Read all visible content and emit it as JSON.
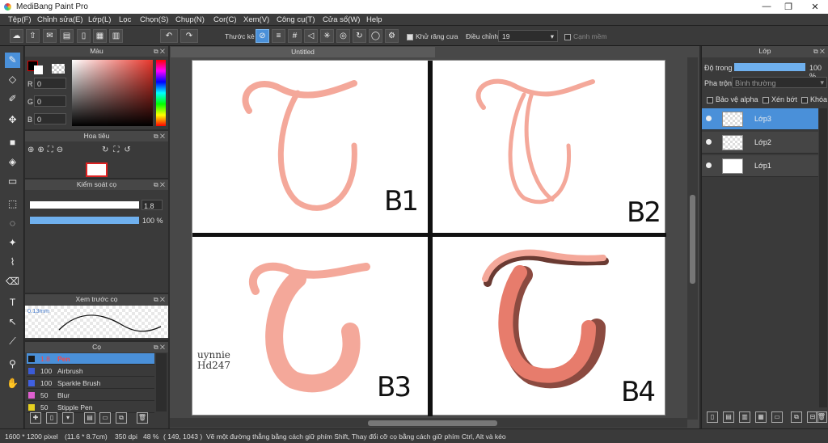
{
  "window": {
    "title": "MediBang Paint Pro",
    "min": "—",
    "max": "❐",
    "close": "✕"
  },
  "menu": [
    "Tệp(F)",
    "Chỉnh sửa(E)",
    "Lớp(L)",
    "Lọc",
    "Chọn(S)",
    "Chụp(N)",
    "Cor(C)",
    "Xem(V)",
    "Công cụ(T)",
    "Cửa sổ(W)",
    "Help"
  ],
  "toolbar": {
    "ruler_label": "Thước kẻ",
    "antialias_label": "Khử răng cưa",
    "antialias_checked": true,
    "correction_label": "Điều chỉnh",
    "correction_value": "19",
    "sharp_label": "Cạnh mềm",
    "sharp_checked": false
  },
  "color_panel": {
    "title": "Màu",
    "r_label": "R",
    "g_label": "G",
    "b_label": "B",
    "r": "0",
    "g": "0",
    "b": "0",
    "primary_color": "#000000"
  },
  "navigator": {
    "title": "Hoa tiêu"
  },
  "brush_control": {
    "title": "Kiểm soát cọ",
    "size": "1.8",
    "opacity": "100 %",
    "opacity_value": 100
  },
  "brush_preview": {
    "title": "Xem trước cọ",
    "size_text": "0.13mm"
  },
  "brush_list": {
    "title": "Cọ",
    "items": [
      {
        "size": "1.8",
        "name": "Pen",
        "color": "#1a1a1a"
      },
      {
        "size": "100",
        "name": "Airbrush",
        "color": "#3b5bd6"
      },
      {
        "size": "100",
        "name": "Sparkle Brush",
        "color": "#4060e0"
      },
      {
        "size": "50",
        "name": "Blur",
        "color": "#e060d0"
      },
      {
        "size": "50",
        "name": "Stipple Pen",
        "color": "#e6d020"
      }
    ]
  },
  "document": {
    "tab": "Untitled"
  },
  "canvas": {
    "labels": [
      "B1",
      "B2",
      "B3",
      "B4"
    ],
    "signature": "uynnie Hd247"
  },
  "layers_panel": {
    "title": "Lớp",
    "opacity_label": "Độ trong",
    "opacity": "100 %",
    "blend_label": "Pha trộn",
    "blend_value": "Bình thường",
    "protect_alpha": "Bảo vệ alpha",
    "clipping": "Xén bớt",
    "lock": "Khóa",
    "layers": [
      {
        "name": "Lớp3",
        "selected": true
      },
      {
        "name": "Lớp2",
        "selected": false
      },
      {
        "name": "Lớp1",
        "selected": false
      }
    ]
  },
  "status": {
    "size": "1600 * 1200 pixel",
    "cm": "(11.6 * 8.7cm)",
    "dpi": "350 dpi",
    "zoom": "48 %",
    "coords": "( 149, 1043 )",
    "hint": "Vẽ một đường thẳng bằng cách giữ phím Shift, Thay đổi cỡ cọ bằng cách giữ phím Ctrl, Alt và kéo"
  }
}
